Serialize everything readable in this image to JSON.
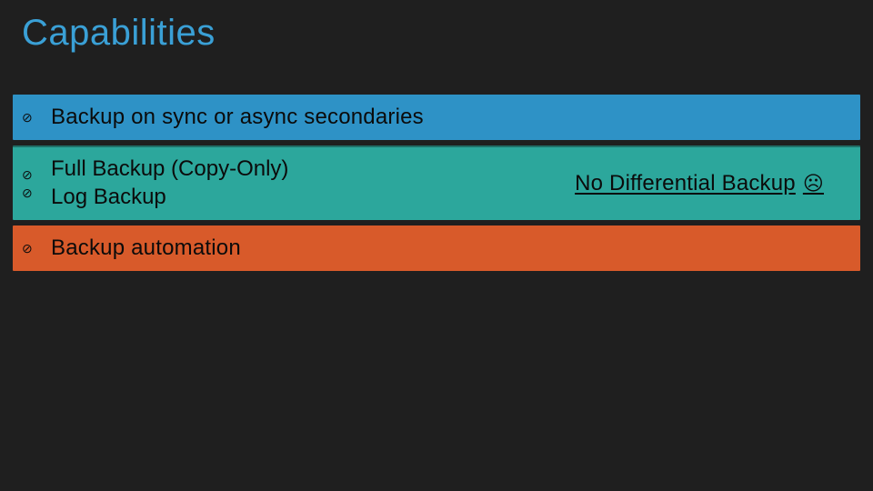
{
  "title": "Capabilities",
  "bullet_glyph": "⊘",
  "bars": {
    "bar1": {
      "text": "Backup on sync or async secondaries"
    },
    "bar2": {
      "line1": "Full Backup (Copy-Only)",
      "line2": "Log Backup",
      "right_note": "No Differential Backup",
      "sad": "☹"
    },
    "bar3": {
      "text": "Backup automation"
    }
  }
}
